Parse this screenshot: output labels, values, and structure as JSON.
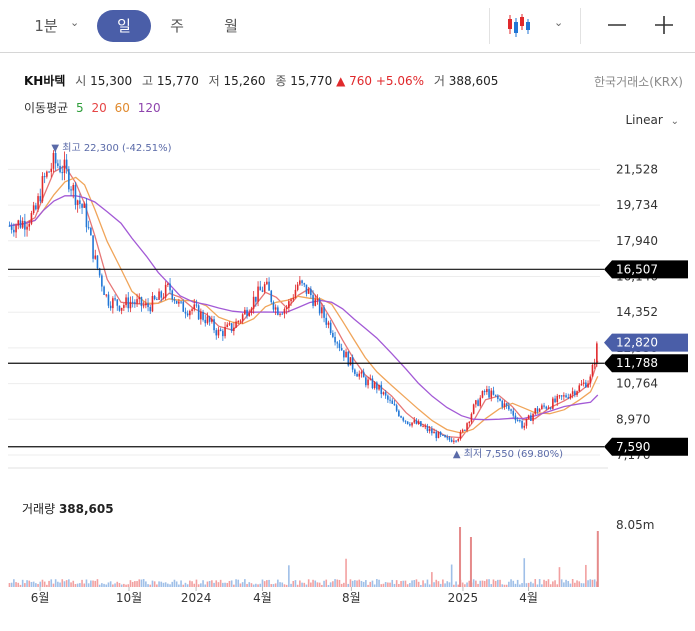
{
  "toolbar": {
    "interval": "1분",
    "tabs": [
      "일",
      "주",
      "월"
    ],
    "selected_tab": "일",
    "chart_type_icon": "candlestick-icon",
    "minus_icon": "minus-icon",
    "plus_icon": "plus-icon"
  },
  "quote": {
    "name": "KH바텍",
    "open_label": "시",
    "open": "15,300",
    "high_label": "고",
    "high": "15,770",
    "low_label": "저",
    "low": "15,260",
    "close_label": "종",
    "close": "15,770",
    "change": "▲ 760",
    "change_pct": "+5.06%",
    "volume_label": "거",
    "volume": "388,605",
    "exchange": "한국거래소(KRX)"
  },
  "moving_average": {
    "label": "이동평균",
    "periods": [
      {
        "period": "5",
        "color": "#2e9e3a"
      },
      {
        "period": "20",
        "color": "#e64545"
      },
      {
        "period": "60",
        "color": "#e08a2e"
      },
      {
        "period": "120",
        "color": "#8e44ad"
      }
    ]
  },
  "scale_mode": "Linear",
  "volume_panel": {
    "label": "거래량",
    "value": "388,605",
    "axis_label": "8.05m"
  },
  "colors": {
    "up": "#e0292c",
    "down": "#2176d6",
    "accent": "#4a5ea8",
    "ma5": "#2e9e3a",
    "ma20": "#e67676",
    "ma60": "#f0a55a",
    "ma120": "#a35ad6"
  },
  "chart_data": {
    "type": "candlestick",
    "x_ticks": [
      "6월",
      "10월",
      "2024",
      "4월",
      "8월",
      "2025",
      "4월"
    ],
    "y_ticks": [
      21528,
      19734,
      17940,
      16146,
      14352,
      12558,
      10764,
      8970,
      7176
    ],
    "y_tick_labels": [
      "21,528",
      "19,734",
      "17,940",
      "16,146",
      "14,352",
      "12,558",
      "10,764",
      "8,970",
      "7,176"
    ],
    "ylim": [
      7176,
      23000
    ],
    "price_series": [
      [
        "2023-04-20",
        18700
      ],
      [
        "2023-05-10",
        18900
      ],
      [
        "2023-05-25",
        19300
      ],
      [
        "2023-06-05",
        20900
      ],
      [
        "2023-06-20",
        21900
      ],
      [
        "2023-07-05",
        21500
      ],
      [
        "2023-07-20",
        20200
      ],
      [
        "2023-08-01",
        19400
      ],
      [
        "2023-08-15",
        17000
      ],
      [
        "2023-09-01",
        15000
      ],
      [
        "2023-09-20",
        14700
      ],
      [
        "2023-10-05",
        14900
      ],
      [
        "2023-10-25",
        14600
      ],
      [
        "2023-11-10",
        15000
      ],
      [
        "2023-11-25",
        15600
      ],
      [
        "2023-12-10",
        14600
      ],
      [
        "2023-12-28",
        14500
      ],
      [
        "2024-01-15",
        14000
      ],
      [
        "2024-02-01",
        13300
      ],
      [
        "2024-02-20",
        13600
      ],
      [
        "2024-03-05",
        14200
      ],
      [
        "2024-03-20",
        15000
      ],
      [
        "2024-04-05",
        15700
      ],
      [
        "2024-04-20",
        14500
      ],
      [
        "2024-05-05",
        14600
      ],
      [
        "2024-05-20",
        15800
      ],
      [
        "2024-06-05",
        15300
      ],
      [
        "2024-06-20",
        14400
      ],
      [
        "2024-07-05",
        13500
      ],
      [
        "2024-07-20",
        12400
      ],
      [
        "2024-08-05",
        11500
      ],
      [
        "2024-08-20",
        10900
      ],
      [
        "2024-09-05",
        10600
      ],
      [
        "2024-09-25",
        9700
      ],
      [
        "2024-10-15",
        8900
      ],
      [
        "2024-11-01",
        8700
      ],
      [
        "2024-11-20",
        8300
      ],
      [
        "2024-12-10",
        7900
      ],
      [
        "2024-12-30",
        8200
      ],
      [
        "2025-01-15",
        9500
      ],
      [
        "2025-02-01",
        10400
      ],
      [
        "2025-02-20",
        9900
      ],
      [
        "2025-03-10",
        9300
      ],
      [
        "2025-03-25",
        8600
      ],
      [
        "2025-04-10",
        9400
      ],
      [
        "2025-04-30",
        9700
      ],
      [
        "2025-05-20",
        10100
      ],
      [
        "2025-06-10",
        10600
      ],
      [
        "2025-06-25",
        11000
      ],
      [
        "2025-07-05",
        12820
      ]
    ],
    "series": [
      {
        "name": "5",
        "values": []
      },
      {
        "name": "20",
        "values": []
      },
      {
        "name": "60",
        "values": []
      },
      {
        "name": "120",
        "values": []
      }
    ],
    "annotations": [
      {
        "label": "최고 22,300 (-42.51%)",
        "value": 22300,
        "date": "2023-06-22"
      },
      {
        "label": "최저 7,550 (69.80%)",
        "value": 7550,
        "date": "2024-12-10"
      }
    ],
    "horizontal_lines": [
      {
        "value": 16507,
        "label": "16,507"
      },
      {
        "value": 11788,
        "label": "11,788"
      },
      {
        "value": 7590,
        "label": "7,590"
      }
    ],
    "current_price": {
      "value": 12820,
      "label": "12,820"
    },
    "volume_max_label": "8.05m"
  }
}
